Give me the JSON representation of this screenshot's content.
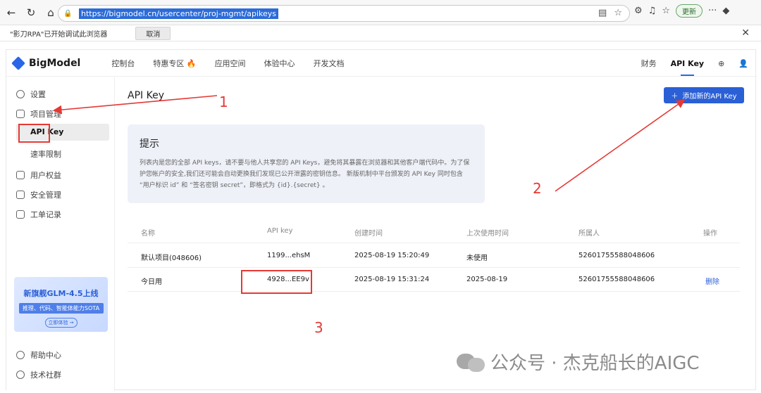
{
  "browser": {
    "url": "https://bigmodel.cn/usercenter/proj-mgmt/apikeys",
    "update_label": "更新",
    "rpa_notice": "\"影刀RPA\"已开始调试此浏览器",
    "rpa_cancel": "取消"
  },
  "app": {
    "logo": "BigModel",
    "nav": [
      "控制台",
      "特惠专区",
      "应用空间",
      "体验中心",
      "开发文档"
    ],
    "nav_right": {
      "finance": "财务",
      "api_key": "API Key"
    }
  },
  "sidebar": {
    "settings": "设置",
    "project_mgmt": "项目管理",
    "api_key": "API Key",
    "rate_limit": "速率限制",
    "user_rights": "用户权益",
    "security": "安全管理",
    "tickets": "工单记录",
    "help": "帮助中心",
    "community": "技术社群",
    "promo": {
      "title": "新旗舰GLM-4.5上线",
      "subtitle": "推理、代码、智能体能力SOTA",
      "cta": "立即体验 →"
    }
  },
  "main": {
    "title": "API Key",
    "add_button": "添加新的API Key",
    "tip": {
      "title": "提示",
      "body": "列表内是您的全部 API keys，请不要与他人共享您的 API Keys，避免将其暴露在浏览器和其他客户端代码中。为了保护您帐户的安全,我们还可能会自动更换我们发现已公开泄露的密钥信息。 新版机制中平台颁发的 API Key 同时包含 “用户标识 id” 和 “签名密钥 secret”，即格式为 {id}.{secret} 。"
    },
    "table": {
      "headers": [
        "名称",
        "API key",
        "创建时间",
        "上次使用时间",
        "所属人",
        "操作"
      ],
      "rows": [
        {
          "name": "默认项目(048606)",
          "key": "1199...ehsM",
          "created": "2025-08-19 15:20:49",
          "last_used": "未使用",
          "owner": "52601755588048606",
          "action": ""
        },
        {
          "name": "今日用",
          "key": "4928...EE9v",
          "created": "2025-08-19 15:31:24",
          "last_used": "2025-08-19",
          "owner": "52601755588048606",
          "action": "删除"
        }
      ]
    }
  },
  "annotations": {
    "n1": "1",
    "n2": "2",
    "n3": "3"
  },
  "watermark": "公众号 · 杰克船长的AIGC",
  "colors": {
    "accent": "#2a5fd6",
    "annotation": "#e53935"
  }
}
